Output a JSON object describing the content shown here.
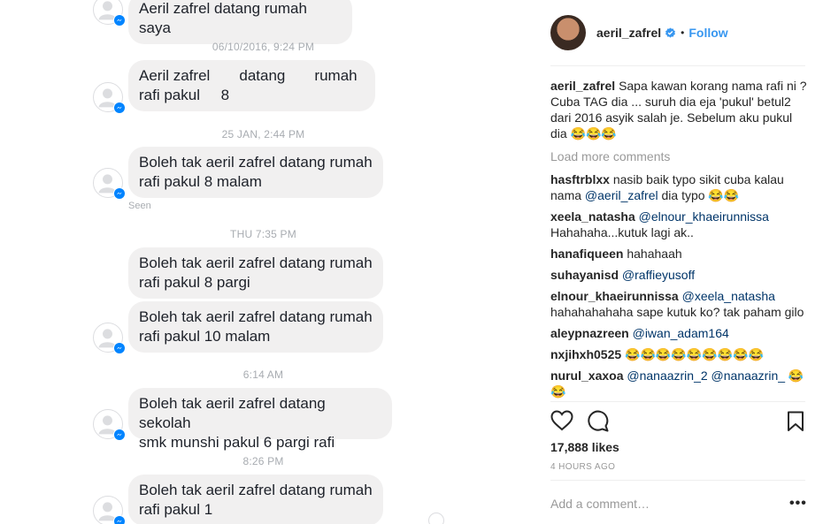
{
  "messenger": {
    "messages": [
      {
        "text": "Aeril zafrel datang rumah saya"
      },
      {
        "timestamp": "06/10/2016, 9:24 PM"
      },
      {
        "text": "Aeril zafrel       datang       rumah\nrafi pakul     8"
      },
      {
        "timestamp": "25 JAN, 2:44 PM"
      },
      {
        "text": "Boleh tak aeril zafrel datang rumah\nrafi pakul 8 malam",
        "status": "Seen"
      },
      {
        "timestamp": "THU 7:35 PM"
      },
      {
        "text": "Boleh tak aeril zafrel datang rumah\nrafi pakul 8 pargi"
      },
      {
        "text": "Boleh tak aeril zafrel datang rumah\nrafi pakul 10 malam"
      },
      {
        "timestamp": "6:14 AM"
      },
      {
        "text": "Boleh tak aeril zafrel datang sekolah\nsmk munshi pakul 6 pargi rafi"
      },
      {
        "timestamp": "8:26 PM"
      },
      {
        "text": "Boleh tak aeril zafrel datang rumah\nrafi pakul 1"
      }
    ]
  },
  "instagram": {
    "username": "aeril_zafrel",
    "separator": "•",
    "follow_label": "Follow",
    "caption": {
      "user": "aeril_zafrel",
      "text": "Sapa kawan korang nama rafi ni ? Cuba TAG dia ... suruh dia eja 'pukul' betul2 dari 2016 asyik salah je. Sebelum aku pukul dia 😂😂😂"
    },
    "load_more": "Load more comments",
    "comments": [
      {
        "user": "hasftrblxx",
        "mention": "",
        "text": "nasib baik typo sikit cuba kalau nama ",
        "mention_inline": "@aeril_zafrel",
        "text_after": " dia typo 😂😂"
      },
      {
        "user": "xeela_natasha",
        "mention": "@elnour_khaeirunnissa",
        "text": "Hahahaha...kutuk lagi ak.."
      },
      {
        "user": "hanafiqueen",
        "mention": "",
        "text": "hahahaah"
      },
      {
        "user": "suhayanisd",
        "mention": "@raffieyusoff",
        "text": ""
      },
      {
        "user": "elnour_khaeirunnissa",
        "mention": "@xeela_natasha",
        "text": "hahahahahaha sape kutuk ko? tak paham gilo"
      },
      {
        "user": "aleypnazreen",
        "mention": "@iwan_adam164",
        "text": ""
      },
      {
        "user": "nxjihxh0525",
        "mention": "",
        "text": "😂😂😂😂😂😂😂😂😂"
      },
      {
        "user": "nurul_xaxoa",
        "mention": "@nanaazrin_2 @nanaazrin_",
        "text": "😂😂"
      }
    ],
    "likes": "17,888 likes",
    "posted": "4 HOURS AGO",
    "add_comment_placeholder": "Add a comment…",
    "more_label": "•••",
    "colors": {
      "link": "#3897f0",
      "mention": "#003569",
      "muted": "#999999"
    }
  }
}
